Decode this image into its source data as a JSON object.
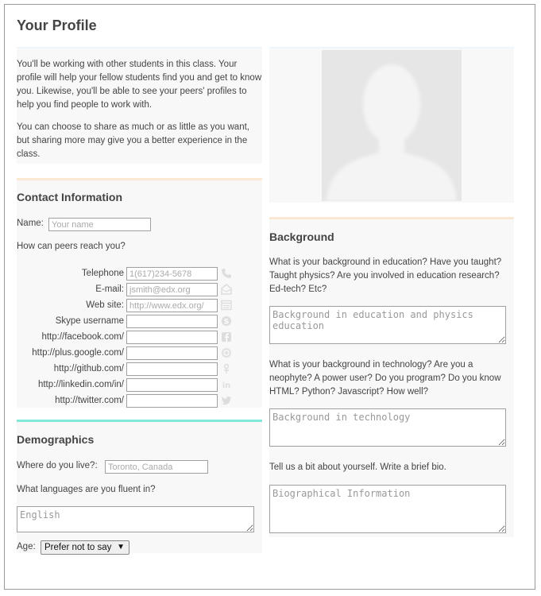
{
  "page_title": "Your Profile",
  "intro": {
    "p1": "You'll be working with other students in this class. Your profile will help your fellow students find you and get to know you. Likewise, you'll be able to see your peers' profiles to help you find people to work with.",
    "p2": "You can choose to share as much or as little as you want, but sharing more may give you a better experience in the class."
  },
  "contact": {
    "title": "Contact Information",
    "name_label": "Name:",
    "name_placeholder": "Your name",
    "reach_question": "How can peers reach you?",
    "fields": [
      {
        "label": "Telephone",
        "placeholder": "1(617)234-5678",
        "icon": "phone-icon"
      },
      {
        "label": "E-mail:",
        "placeholder": "jsmith@edx.org",
        "icon": "email-icon"
      },
      {
        "label": "Web site:",
        "placeholder": "http://www.edx.org/",
        "icon": "website-icon"
      },
      {
        "label": "Skype username",
        "placeholder": "",
        "icon": "skype-icon"
      },
      {
        "label": "http://facebook.com/",
        "placeholder": "",
        "icon": "facebook-icon"
      },
      {
        "label": "http://plus.google.com/",
        "placeholder": "",
        "icon": "google-plus-icon"
      },
      {
        "label": "http://github.com/",
        "placeholder": "",
        "icon": "github-icon"
      },
      {
        "label": "http://linkedin.com/in/",
        "placeholder": "",
        "icon": "linkedin-icon"
      },
      {
        "label": "http://twitter.com/",
        "placeholder": "",
        "icon": "twitter-icon"
      }
    ]
  },
  "demographics": {
    "title": "Demographics",
    "location_label": "Where do you live?:",
    "location_placeholder": "Toronto, Canada",
    "languages_question": "What languages are you fluent in?",
    "languages_placeholder": "English",
    "age_label": "Age:",
    "age_selected": "Prefer not to say"
  },
  "background": {
    "title": "Background",
    "education_question": "What is your background in education? Have you taught? Taught physics? Are you involved in education research? Ed-tech? Etc?",
    "education_placeholder": "Background in education and physics education",
    "technology_question": "What is your background in technology? Are you a neophyte? A power user? Do you program? Do you know HTML? Python? Javascript? How well?",
    "technology_placeholder": "Background in technology",
    "bio_question": "Tell us a bit about yourself. Write a brief bio.",
    "bio_placeholder": "Biographical Information"
  },
  "colors": {
    "accent_orange": "#fbe8d3",
    "accent_teal": "#7fe8d8",
    "panel_bg": "#f8f8f8"
  }
}
